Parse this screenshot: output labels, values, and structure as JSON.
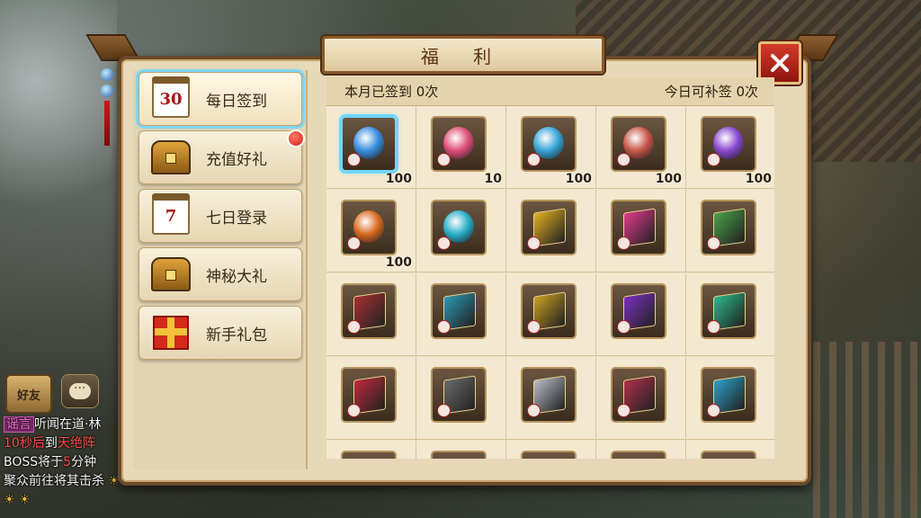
{
  "window": {
    "title": "福 利"
  },
  "hud": {
    "friend_label": "好友",
    "chat_lines": [
      {
        "tag": "谣言",
        "text": "听闻在道·林"
      },
      {
        "red1": "10秒后",
        "text": "到",
        "red2": "天绝阵"
      },
      {
        "prefix": "BOSS将于",
        "red": "5",
        "suffix": "分钟"
      },
      {
        "text": "聚众前往将其击杀",
        "icons": "☀ ☀ ☀"
      }
    ]
  },
  "sidebar": {
    "items": [
      {
        "label": "每日签到",
        "icon": "calendar-30-icon",
        "active": true,
        "badge": false
      },
      {
        "label": "充值好礼",
        "icon": "treasure-chest-icon",
        "active": false,
        "badge": true
      },
      {
        "label": "七日登录",
        "icon": "calendar-7-icon",
        "active": false,
        "badge": false
      },
      {
        "label": "神秘大礼",
        "icon": "open-chest-icon",
        "active": false,
        "badge": false
      },
      {
        "label": "新手礼包",
        "icon": "gift-box-icon",
        "active": false,
        "badge": false
      }
    ],
    "calendar_numbers": {
      "daily": "30",
      "seven_day": "7"
    }
  },
  "stats": {
    "signed_this_month": "本月已签到 0次",
    "makeup_today": "今日可补签 0次"
  },
  "rewards": [
    {
      "name": "blue-crystal",
      "qty": "100",
      "color": "#3a8fe0",
      "selected": true
    },
    {
      "name": "pink-orb",
      "qty": "10",
      "color": "#e0507a"
    },
    {
      "name": "blue-drop-gem",
      "qty": "100",
      "color": "#39a6d8"
    },
    {
      "name": "red-ore-pile",
      "qty": "100",
      "color": "#c9584a"
    },
    {
      "name": "purple-crystal",
      "qty": "100",
      "color": "#8a4ad0"
    },
    {
      "name": "fire-orb",
      "qty": "100",
      "color": "#d96a20"
    },
    {
      "name": "cyan-swirl-orb",
      "qty": "",
      "color": "#2ab0c8"
    },
    {
      "name": "gold-book",
      "qty": "",
      "color": "#e2b020"
    },
    {
      "name": "pink-book",
      "qty": "",
      "color": "#e03a8a"
    },
    {
      "name": "green-book",
      "qty": "",
      "color": "#4aa04a"
    },
    {
      "name": "red-book",
      "qty": "",
      "color": "#a83030"
    },
    {
      "name": "teal-book",
      "qty": "",
      "color": "#2a9ab0"
    },
    {
      "name": "gold-tome",
      "qty": "",
      "color": "#c8a020"
    },
    {
      "name": "purple-tome",
      "qty": "",
      "color": "#7a30c0"
    },
    {
      "name": "jade-tome",
      "qty": "",
      "color": "#2ab88a"
    },
    {
      "name": "crimson-tome",
      "qty": "",
      "color": "#c02a3a"
    },
    {
      "name": "grey-tome",
      "qty": "",
      "color": "#6a6a6a"
    },
    {
      "name": "silver-tome",
      "qty": "",
      "color": "#b8bcc8"
    },
    {
      "name": "rose-tome",
      "qty": "",
      "color": "#b0304a"
    },
    {
      "name": "aqua-tome",
      "qty": "",
      "color": "#2aa0c8"
    },
    {
      "name": "partial-1",
      "qty": "",
      "color": "#6a5a40"
    },
    {
      "name": "partial-2",
      "qty": "",
      "color": "#6a5a40"
    },
    {
      "name": "partial-3",
      "qty": "",
      "color": "#6a5a40"
    },
    {
      "name": "partial-4",
      "qty": "",
      "color": "#6a5a40"
    },
    {
      "name": "partial-5",
      "qty": "",
      "color": "#6a5a40"
    }
  ]
}
